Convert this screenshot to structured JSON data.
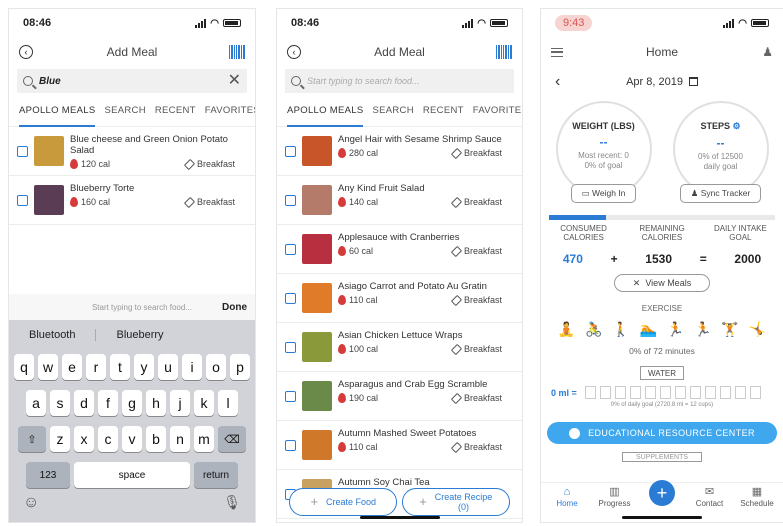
{
  "phone1": {
    "time": "08:46",
    "title": "Add Meal",
    "search_value": "Blue",
    "tabs": [
      "APOLLO MEALS",
      "SEARCH",
      "RECENT",
      "FAVORITES"
    ],
    "items": [
      {
        "name": "Blue cheese and Green Onion Potato Salad",
        "cal": "120 cal",
        "meal": "Breakfast",
        "color": "#c89a3b"
      },
      {
        "name": "Blueberry Torte",
        "cal": "160 cal",
        "meal": "Breakfast",
        "color": "#5a3d55"
      }
    ],
    "keyboard": {
      "accessory_placeholder": "Start typing to search food...",
      "done": "Done",
      "suggestions": [
        "Bluetooth",
        "Blueberry"
      ],
      "row1": [
        "q",
        "w",
        "e",
        "r",
        "t",
        "y",
        "u",
        "i",
        "o",
        "p"
      ],
      "row2": [
        "a",
        "s",
        "d",
        "f",
        "g",
        "h",
        "j",
        "k",
        "l"
      ],
      "row3": [
        "z",
        "x",
        "c",
        "v",
        "b",
        "n",
        "m"
      ],
      "num": "123",
      "space": "space",
      "return": "return"
    }
  },
  "phone2": {
    "time": "08:46",
    "title": "Add Meal",
    "search_placeholder": "Start typing to search food...",
    "tabs": [
      "APOLLO MEALS",
      "SEARCH",
      "RECENT",
      "FAVORITES"
    ],
    "items": [
      {
        "name": "Angel Hair with Sesame Shrimp Sauce",
        "cal": "280 cal",
        "meal": "Breakfast",
        "color": "#c8542a"
      },
      {
        "name": "Any Kind Fruit Salad",
        "cal": "140 cal",
        "meal": "Breakfast",
        "color": "#b57b6a"
      },
      {
        "name": "Applesauce with Cranberries",
        "cal": "60 cal",
        "meal": "Breakfast",
        "color": "#b83040"
      },
      {
        "name": "Asiago Carrot and Potato Au Gratin",
        "cal": "110 cal",
        "meal": "Breakfast",
        "color": "#e07b2a"
      },
      {
        "name": "Asian Chicken Lettuce Wraps",
        "cal": "100 cal",
        "meal": "Breakfast",
        "color": "#8a9a3a"
      },
      {
        "name": "Asparagus and Crab Egg Scramble",
        "cal": "190 cal",
        "meal": "Breakfast",
        "color": "#6a8a4a"
      },
      {
        "name": "Autumn Mashed Sweet Potatoes",
        "cal": "110 cal",
        "meal": "Breakfast",
        "color": "#d0782a"
      },
      {
        "name": "Autumn Soy Chai Tea",
        "cal": "",
        "meal": "",
        "color": "#c8a060"
      }
    ],
    "create_food": "Create Food",
    "create_recipe": "Create Recipe\n(0)"
  },
  "phone3": {
    "time": "9:43",
    "title": "Home",
    "date": "Apr 8, 2019",
    "weight": {
      "title": "WEIGHT (LBS)",
      "value": "--",
      "sub": "Most recent: 0\n0% of goal",
      "button": "Weigh In"
    },
    "steps": {
      "title": "STEPS",
      "value": "--",
      "sub": "0% of 12500\ndaily goal",
      "button": "Sync Tracker"
    },
    "progress_fraction": 0.25,
    "consumed_label": "CONSUMED\nCALORIES",
    "remaining_label": "REMAINING\nCALORIES",
    "daily_label": "DAILY INTAKE\nGOAL",
    "consumed": "470",
    "plus": "+",
    "remaining": "1530",
    "equals": "=",
    "daily": "2000",
    "view_meals": "View Meals",
    "exercise_label": "EXERCISE",
    "exercise_minutes": "0% of 72 minutes",
    "water_button": "WATER",
    "water_ml": "0 ml =",
    "water_goal": "0% of daily goal (2720.8 ml = 12 cups)",
    "edu": "EDUCATIONAL RESOURCE CENTER",
    "supplements": "SUPPLEMENTS",
    "nav": [
      "Home",
      "Progress",
      "Contact",
      "Schedule"
    ]
  }
}
